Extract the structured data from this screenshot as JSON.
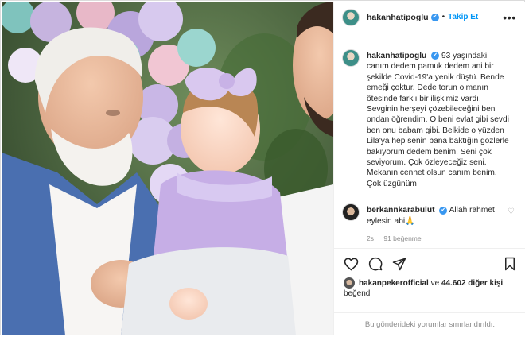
{
  "post": {
    "username": "hakanhatipoglu",
    "verified_mark": "✔",
    "separator": "•",
    "follow_label": "Takip Et",
    "more_label": "•••",
    "caption": "93 yaşındaki canım dedem pamuk dedem ani bir şekilde Covid-19'a yenik düştü. Bende emeği çoktur. Dede torun olmanın ötesinde farklı bir ilişkimiz vardı. Sevginin herşeyi çözebileceğini ben ondan öğrendim. O beni evlat gibi sevdi ben onu babam gibi. Belkide o yüzden Lila'ya hep senin bana baktığın gözlerle bakıyorum dedem benim. Seni çok seviyorum. Çok özleyeceğiz seni. Mekanın cennet olsun canım benim. Çok üzgünüm"
  },
  "comment": {
    "username": "berkannkarabulut",
    "text": "Allah rahmet eylesin abi🙏",
    "time": "2s",
    "likes": "91 beğenme"
  },
  "likes": {
    "first_user": "hakanpekerofficial",
    "joiner": "ve",
    "others": "44.602 diğer kişi",
    "suffix": "beğendi"
  },
  "date_label": "",
  "footer": {
    "restricted": "Bu gönderideki yorumlar sınırlandırıldı."
  },
  "icons": {
    "like": "heart-icon",
    "comment": "comment-icon",
    "share": "share-icon",
    "save": "bookmark-icon",
    "more": "more-icon"
  },
  "colors": {
    "accent": "#0095f6",
    "verified": "#3897f0",
    "muted": "#8e8e8e"
  }
}
